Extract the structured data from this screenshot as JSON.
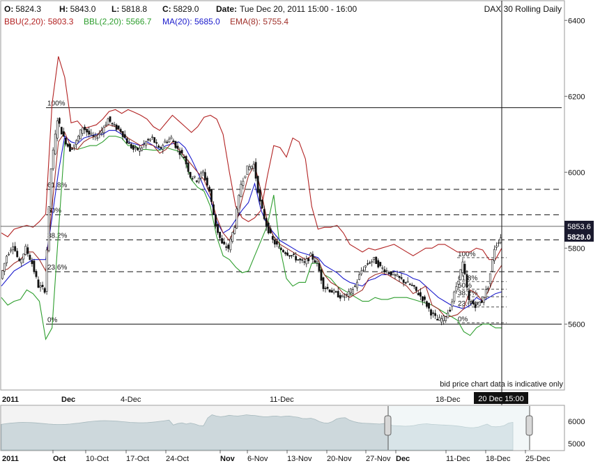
{
  "header": {
    "o_label": "O:",
    "o_value": "5824.3",
    "h_label": "H:",
    "h_value": "5843.0",
    "l_label": "L:",
    "l_value": "5818.8",
    "c_label": "C:",
    "c_value": "5829.0",
    "date_label": "Date:",
    "date_value": "Tue Dec 20, 2011 15:00 - 16:00",
    "instrument": "DAX 30  Rolling Daily"
  },
  "indicators": {
    "bbu": "BBU(2,20): 5803.3",
    "bbl": "BBL(2,20): 5566.7",
    "ma": "MA(20): 5685.0",
    "ema": "EMA(8): 5755.4"
  },
  "colors": {
    "bbu": "#b22222",
    "bbl": "#2e9e2e",
    "ma": "#1a1acc",
    "ema": "#a0302a",
    "candle": "#111111",
    "nav_fill": "#c5d6dc",
    "nav_sel_fill": "#a9c7cf",
    "price_tag": "#1a1a2e"
  },
  "price_tags": {
    "last": "5853.6",
    "close": "5829.0"
  },
  "crosshair_label": "20 Dec 15:00",
  "disclaimer": "bid price chart data is indicative only",
  "fib_main": [
    {
      "label": "100%",
      "value": 6170
    },
    {
      "label": "61.8%",
      "value": 5955
    },
    {
      "label": "50%",
      "value": 5888
    },
    {
      "label": "38.2%",
      "value": 5822
    },
    {
      "label": "23.6%",
      "value": 5738
    },
    {
      "label": "0%",
      "value": 5600
    }
  ],
  "fib_small": [
    {
      "label": "100%",
      "value": 5775
    },
    {
      "label": "61.8%",
      "value": 5712
    },
    {
      "label": "50%",
      "value": 5692
    },
    {
      "label": "38.2%",
      "value": 5672
    },
    {
      "label": "23.6%",
      "value": 5645
    },
    {
      "label": "0%",
      "value": 5603
    }
  ],
  "nav_bar": {
    "year": "2011",
    "ticks": [
      "Oct",
      "10-Oct",
      "17-Oct",
      "24-Oct",
      "Nov",
      "6-Nov",
      "13-Nov",
      "20-Nov",
      "27-Nov",
      "Dec",
      "11-Dec",
      "18-Dec",
      "25-Dec"
    ],
    "y_ticks": [
      "6000",
      "5000"
    ]
  },
  "chart_data": {
    "type": "line",
    "title": "DAX 30  Rolling Daily",
    "xlabel": "",
    "ylabel": "",
    "ylim": [
      5430,
      6450
    ],
    "y_ticks": [
      5600,
      5800,
      6000,
      6200,
      6400
    ],
    "x_ticks": [
      "2011",
      "Dec",
      "4-Dec",
      "11-Dec",
      "18-Dec"
    ],
    "grid": false,
    "series": [
      {
        "name": "BBU(2,20)",
        "values": [
          5840,
          5830,
          5850,
          5855,
          5860,
          5855,
          5870,
          5890,
          6180,
          6305,
          6250,
          6130,
          6135,
          6115,
          6120,
          6125,
          6140,
          6160,
          6165,
          6155,
          6165,
          6158,
          6150,
          6140,
          6120,
          6110,
          6130,
          6150,
          6135,
          6120,
          6105,
          6120,
          6145,
          6150,
          6140,
          6100,
          6000,
          5910,
          5880,
          5870,
          5880,
          5900,
          5990,
          6070,
          6065,
          6040,
          6090,
          6080,
          6035,
          5910,
          5850,
          5855,
          5855,
          5860,
          5840,
          5810,
          5800,
          5790,
          5800,
          5795,
          5800,
          5805,
          5810,
          5800,
          5790,
          5780,
          5790,
          5800,
          5800,
          5810,
          5810,
          5800,
          5790,
          5790,
          5790,
          5800,
          5795,
          5770,
          5770,
          5800
        ]
      },
      {
        "name": "BBL(2,20)",
        "values": [
          5670,
          5650,
          5660,
          5665,
          5690,
          5680,
          5660,
          5560,
          5590,
          5840,
          6080,
          6065,
          6060,
          6065,
          6070,
          6070,
          6080,
          6095,
          6095,
          6090,
          6070,
          6070,
          6060,
          6060,
          6058,
          6058,
          6065,
          6060,
          6055,
          6030,
          5980,
          5960,
          5950,
          5910,
          5830,
          5780,
          5770,
          5750,
          5735,
          5740,
          5780,
          5820,
          5860,
          5940,
          5800,
          5720,
          5700,
          5710,
          5710,
          5760,
          5760,
          5730,
          5720,
          5700,
          5690,
          5680,
          5670,
          5660,
          5660,
          5670,
          5665,
          5665,
          5670,
          5670,
          5670,
          5665,
          5660,
          5655,
          5650,
          5640,
          5630,
          5620,
          5610,
          5580,
          5570,
          5590,
          5600,
          5600,
          5590,
          5590
        ]
      },
      {
        "name": "MA(20)",
        "values": [
          5700,
          5720,
          5740,
          5750,
          5760,
          5770,
          5770,
          5770,
          5880,
          6000,
          6095,
          6080,
          6075,
          6090,
          6095,
          6100,
          6100,
          6110,
          6110,
          6100,
          6080,
          6075,
          6070,
          6080,
          6070,
          6060,
          6070,
          6075,
          6080,
          6065,
          6035,
          6000,
          5960,
          5930,
          5870,
          5840,
          5850,
          5875,
          5900,
          5920,
          5970,
          5900,
          5860,
          5840,
          5820,
          5810,
          5800,
          5790,
          5785,
          5780,
          5775,
          5755,
          5745,
          5735,
          5720,
          5710,
          5705,
          5700,
          5715,
          5720,
          5730,
          5730,
          5740,
          5735,
          5730,
          5720,
          5715,
          5700,
          5685,
          5670,
          5660,
          5650,
          5645,
          5640,
          5650,
          5670,
          5660,
          5670,
          5680,
          5685
        ]
      },
      {
        "name": "EMA(8)",
        "values": [
          5740,
          5745,
          5760,
          5770,
          5790,
          5790,
          5770,
          5740,
          5910,
          6080,
          6105,
          6065,
          6060,
          6080,
          6090,
          6095,
          6115,
          6125,
          6120,
          6105,
          6090,
          6080,
          6070,
          6075,
          6070,
          6050,
          6060,
          6080,
          6060,
          6040,
          6020,
          6000,
          5980,
          5940,
          5880,
          5840,
          5820,
          5860,
          5930,
          5990,
          6020,
          5950,
          5870,
          5830,
          5810,
          5800,
          5790,
          5780,
          5770,
          5780,
          5770,
          5730,
          5710,
          5700,
          5680,
          5670,
          5680,
          5690,
          5720,
          5730,
          5735,
          5730,
          5720,
          5710,
          5700,
          5680,
          5690,
          5700,
          5650,
          5640,
          5620,
          5620,
          5625,
          5640,
          5690,
          5680,
          5660,
          5690,
          5730,
          5755
        ]
      },
      {
        "name": "Price",
        "values": [
          5720,
          5780,
          5810,
          5760,
          5800,
          5760,
          5700,
          5690,
          6010,
          6140,
          6090,
          6060,
          6080,
          6120,
          6100,
          6090,
          6110,
          6140,
          6120,
          6110,
          6080,
          6060,
          6060,
          6080,
          6090,
          6060,
          6080,
          6090,
          6060,
          6040,
          5990,
          5980,
          6000,
          5950,
          5860,
          5810,
          5800,
          5860,
          5970,
          6010,
          6020,
          5920,
          5860,
          5820,
          5800,
          5790,
          5780,
          5770,
          5760,
          5780,
          5760,
          5700,
          5690,
          5680,
          5670,
          5680,
          5700,
          5740,
          5760,
          5770,
          5750,
          5740,
          5730,
          5720,
          5710,
          5700,
          5680,
          5660,
          5630,
          5610,
          5615,
          5640,
          5700,
          5760,
          5660,
          5650,
          5660,
          5700,
          5800,
          5829
        ]
      }
    ]
  }
}
